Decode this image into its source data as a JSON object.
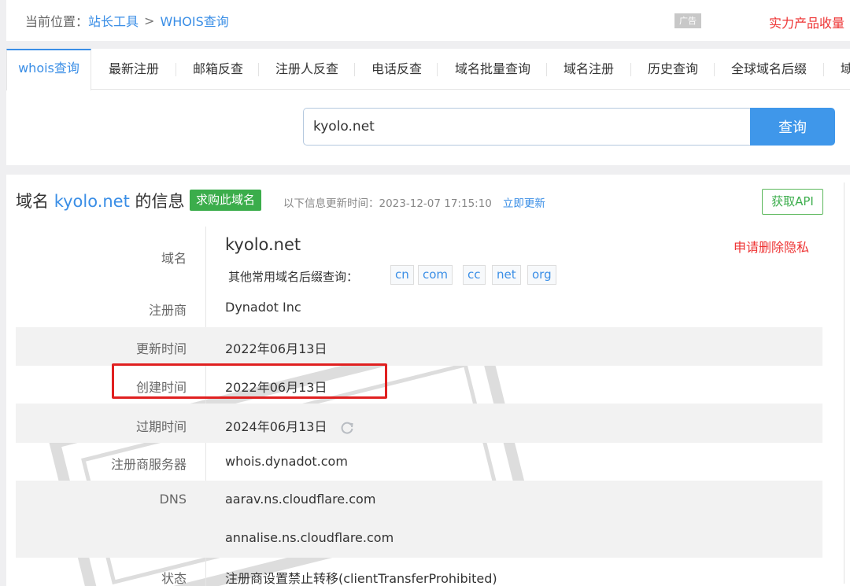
{
  "breadcrumb": {
    "prefix": "当前位置：",
    "root": "站长工具",
    "separator": ">",
    "current": "WHOIS查询"
  },
  "ad_badge": "广告",
  "promo_link": "实力产品收量",
  "tabs": [
    {
      "label": "whois查询",
      "active": true
    },
    {
      "label": "最新注册"
    },
    {
      "label": "邮箱反查"
    },
    {
      "label": "注册人反查"
    },
    {
      "label": "电话反查"
    },
    {
      "label": "域名批量查询"
    },
    {
      "label": "域名注册"
    },
    {
      "label": "历史查询"
    },
    {
      "label": "全球域名后缀"
    },
    {
      "label": "域"
    }
  ],
  "search": {
    "value": "kyolo.net",
    "button_label": "查询"
  },
  "info": {
    "title_prefix": "域名",
    "title_domain": "kyolo.net",
    "title_suffix": "的信息",
    "buy_label": "求购此域名",
    "update_label": "以下信息更新时间：",
    "update_time": "2023-12-07 17:15:10",
    "update_link": "立即更新",
    "api_label": "获取API"
  },
  "whois": {
    "domain_label": "域名",
    "domain_value": "kyolo.net",
    "delete_privacy": "申请删除隐私",
    "suffix_label": "其他常用域名后缀查询：",
    "suffixes": [
      "cn",
      "com",
      "cc",
      "net",
      "org"
    ],
    "rows": [
      {
        "label": "注册商",
        "value": "Dynadot Inc"
      },
      {
        "label": "更新时间",
        "value": "2022年06月13日"
      },
      {
        "label": "创建时间",
        "value": "2022年06月13日"
      },
      {
        "label": "过期时间",
        "value": "2024年06月13日"
      },
      {
        "label": "注册商服务器",
        "value": "whois.dynadot.com"
      },
      {
        "label": "DNS",
        "value": "aarav.ns.cloudflare.com"
      },
      {
        "label": "",
        "value": "annalise.ns.cloudflare.com"
      },
      {
        "label": "状态",
        "value": "注册商设置禁止转移(clientTransferProhibited)"
      }
    ]
  },
  "colors": {
    "link_blue": "#3a8ee6",
    "button_blue": "#3f97ea",
    "green": "#3bad4b",
    "red": "#e33333",
    "highlight_red": "#e02020"
  },
  "icons": {
    "refresh": "refresh-icon"
  }
}
